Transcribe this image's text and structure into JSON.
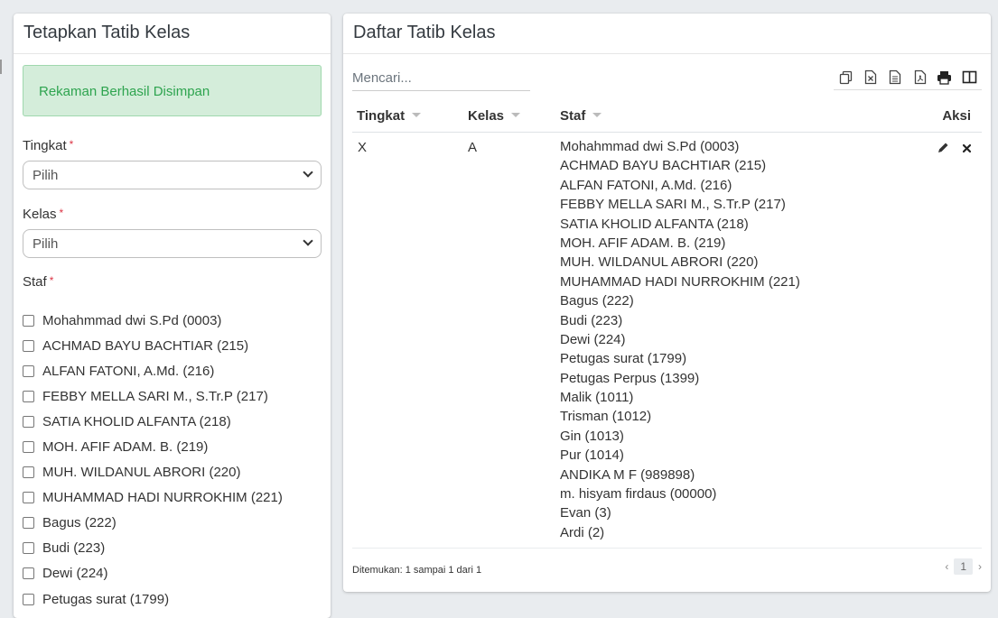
{
  "form": {
    "title": "Tetapkan Tatib Kelas",
    "alert": "Rekaman Berhasil Disimpan",
    "tingkat_label": "Tingkat",
    "tingkat_value": "Pilih",
    "kelas_label": "Kelas",
    "kelas_value": "Pilih",
    "staf_label": "Staf",
    "required_mark": "*",
    "staf_options": [
      "Mohahmmad dwi S.Pd (0003)",
      "ACHMAD BAYU BACHTIAR (215)",
      "ALFAN FATONI, A.Md. (216)",
      "FEBBY MELLA SARI M., S.Tr.P (217)",
      "SATIA KHOLID ALFANTA (218)",
      "MOH. AFIF ADAM. B. (219)",
      "MUH. WILDANUL ABRORI (220)",
      "MUHAMMAD HADI NURROKHIM (221)",
      "Bagus (222)",
      "Budi (223)",
      "Dewi (224)",
      "Petugas surat (1799)"
    ]
  },
  "list": {
    "title": "Daftar Tatib Kelas",
    "search_placeholder": "Mencari...",
    "columns": {
      "tingkat": "Tingkat",
      "kelas": "Kelas",
      "staf": "Staf",
      "aksi": "Aksi"
    },
    "row": {
      "tingkat": "X",
      "kelas": "A",
      "staf": [
        "Mohahmmad dwi S.Pd (0003)",
        "ACHMAD BAYU BACHTIAR (215)",
        "ALFAN FATONI, A.Md. (216)",
        "FEBBY MELLA SARI M., S.Tr.P (217)",
        "SATIA KHOLID ALFANTA (218)",
        "MOH. AFIF ADAM. B. (219)",
        "MUH. WILDANUL ABRORI (220)",
        "MUHAMMAD HADI NURROKHIM (221)",
        "Bagus (222)",
        "Budi (223)",
        "Dewi (224)",
        "Petugas surat (1799)",
        "Petugas Perpus (1399)",
        "Malik (1011)",
        "Trisman (1012)",
        "Gin (1013)",
        "Pur (1014)",
        "ANDIKA M F (989898)",
        "m. hisyam firdaus (00000)",
        "Evan (3)",
        "Ardi (2)"
      ]
    },
    "footer": "Ditemukan: 1 sampai 1 dari 1",
    "page": "1",
    "prev": "‹",
    "next": "›"
  },
  "icons": {
    "toolbar": [
      "copy-icon",
      "excel-icon",
      "csv-icon",
      "pdf-icon",
      "print-icon",
      "columns-icon"
    ],
    "edit": "pencil-icon",
    "delete": "close-icon"
  },
  "colors": {
    "alert_bg": "#d4edda",
    "alert_text": "#2ea44f",
    "required": "#dc3545"
  }
}
